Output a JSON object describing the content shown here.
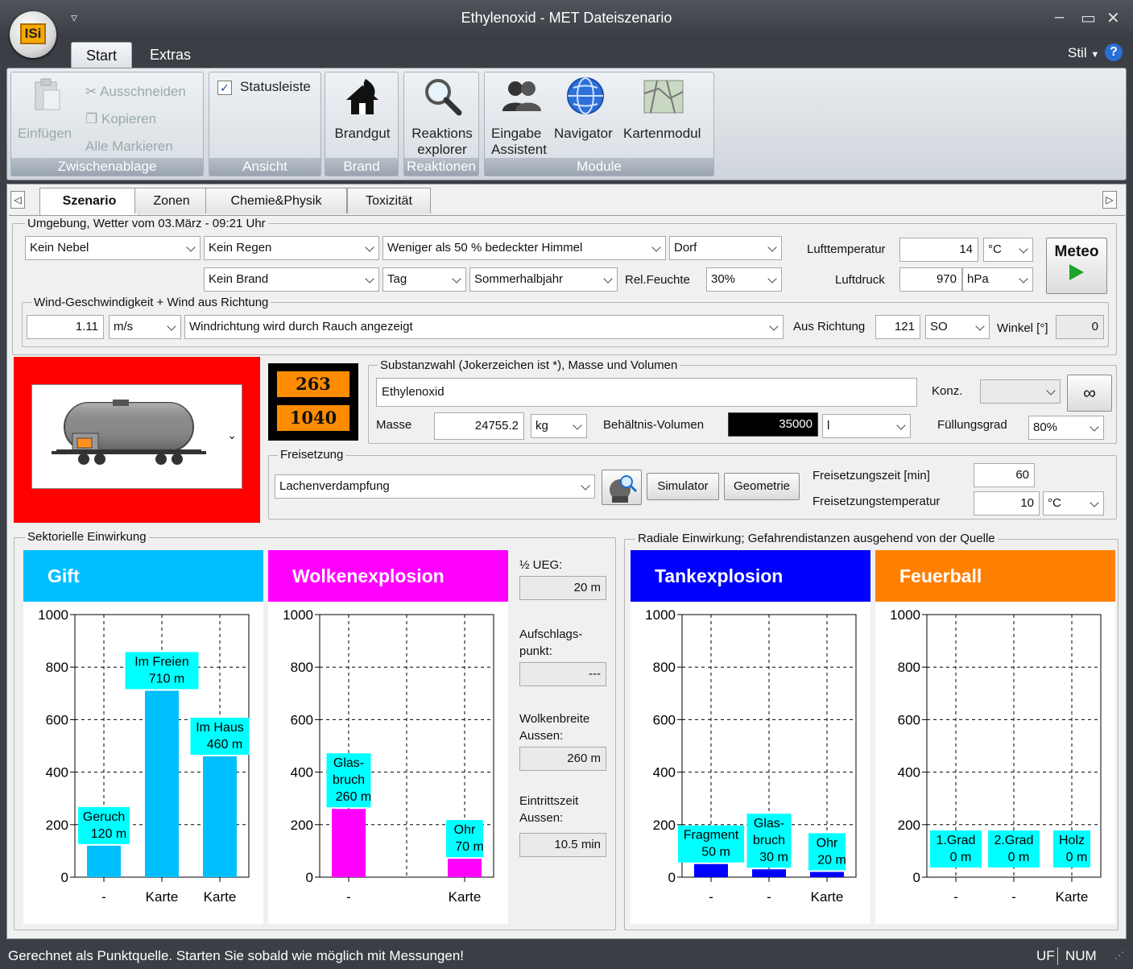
{
  "window": {
    "title": "Ethylenoxid - MET Dateiszenario",
    "logo": "ISi",
    "min": "–",
    "max": "▭",
    "close": "✕",
    "qat": "▿"
  },
  "ribbon": {
    "tabs": [
      "Start",
      "Extras"
    ],
    "style_label": "Stil",
    "help": "?",
    "clipboard": {
      "paste": "Einfügen",
      "cut": "Ausschneiden",
      "copy": "Kopieren",
      "select_all": "Alle Markieren",
      "caption": "Zwischenablage"
    },
    "view": {
      "statusbar": "Statusleiste",
      "caption": "Ansicht"
    },
    "fire": {
      "fuel": "Brandgut",
      "caption": "Brand"
    },
    "reactions": {
      "explorer_line1": "Reaktions",
      "explorer_line2": "explorer",
      "caption": "Reaktionen"
    },
    "modules": {
      "input_line1": "Eingabe",
      "input_line2": "Assistent",
      "navigator": "Navigator",
      "map": "Kartenmodul",
      "caption": "Module"
    }
  },
  "tabs": [
    "Szenario",
    "Zonen",
    "Chemie&Physik",
    "Toxizität"
  ],
  "environment": {
    "legend": "Umgebung, Wetter vom 03.März - 09:21 Uhr",
    "fog": "Kein Nebel",
    "rain": "Kein Regen",
    "sky": "Weniger als 50 % bedeckter Himmel",
    "terrain": "Dorf",
    "fire": "Kein Brand",
    "daytime": "Tag",
    "season": "Sommerhalbjahr",
    "humidity_label": "Rel.Feuchte",
    "humidity": "30%",
    "air_temp_label": "Lufttemperatur",
    "air_temp": "14",
    "air_temp_unit": "°C",
    "pressure_label": "Luftdruck",
    "pressure": "970",
    "pressure_unit": "hPa",
    "meteo_button": "Meteo",
    "wind_legend": "Wind-Geschwindigkeit + Wind aus Richtung",
    "wind_speed": "1.11",
    "wind_unit": "m/s",
    "wind_mode": "Windrichtung wird durch Rauch angezeigt",
    "direction_label": "Aus Richtung",
    "direction": "121",
    "direction_text": "SO",
    "angle_label": "Winkel [°]",
    "angle": "0"
  },
  "hazard_plate": {
    "top": "263",
    "bottom": "1040"
  },
  "substance": {
    "legend": "Substanzwahl (Jokerzeichen ist *), Masse und Volumen",
    "name": "Ethylenoxid",
    "conc_label": "Konz.",
    "conc": "",
    "mass_label": "Masse",
    "mass": "24755.2",
    "mass_unit": "kg",
    "volume_label": "Behältnis-Volumen",
    "volume": "35000",
    "volume_unit": "l",
    "fill_label": "Füllungsgrad",
    "fill": "80%"
  },
  "release": {
    "legend": "Freisetzung",
    "mode": "Lachenverdampfung",
    "simulator": "Simulator",
    "geometry": "Geometrie",
    "time_label": "Freisetzungszeit [min]",
    "time": "60",
    "temp_label": "Freisetzungstemperatur",
    "temp": "10",
    "temp_unit": "°C"
  },
  "sector": {
    "legend": "Sektorielle Einwirkung",
    "gift_title": "Gift",
    "cloud_title": "Wolkenexplosion",
    "ueg_label": "½ UEG:",
    "ueg": "20 m",
    "impact_label1": "Aufschlags-",
    "impact_label2": "punkt:",
    "impact": "---",
    "width_label1": "Wolkenbreite",
    "width_label2": "Aussen:",
    "width": "260 m",
    "entry_label1": "Eintrittszeit",
    "entry_label2": "Aussen:",
    "entry": "10.5 min"
  },
  "radial": {
    "legend": "Radiale Einwirkung;  Gefahrendistanzen ausgehend von der Quelle",
    "tank_title": "Tankexplosion",
    "fire_title": "Feuerball"
  },
  "chart_data": [
    {
      "type": "bar",
      "title": "Gift",
      "ylim": [
        0,
        1000
      ],
      "yticks": [
        0,
        200,
        400,
        600,
        800,
        1000
      ],
      "categories": [
        "-",
        "Karte",
        "Karte"
      ],
      "values": [
        120,
        710,
        460
      ],
      "labels": [
        [
          "Geruch",
          "120 m"
        ],
        [
          "Im Freien",
          "710 m"
        ],
        [
          "Im Haus",
          "460 m"
        ]
      ],
      "color": "#00bfff"
    },
    {
      "type": "bar",
      "title": "Wolkenexplosion",
      "ylim": [
        0,
        1000
      ],
      "yticks": [
        0,
        200,
        400,
        600,
        800,
        1000
      ],
      "categories": [
        "-",
        "Karte"
      ],
      "values": [
        260,
        70
      ],
      "labels": [
        [
          "Glas-",
          "bruch",
          "260 m"
        ],
        [
          "Ohr",
          "70 m"
        ]
      ],
      "color": "#ff00ff"
    },
    {
      "type": "bar",
      "title": "Tankexplosion",
      "ylim": [
        0,
        1000
      ],
      "yticks": [
        0,
        200,
        400,
        600,
        800,
        1000
      ],
      "categories": [
        "-",
        "-",
        "Karte"
      ],
      "values": [
        50,
        30,
        20
      ],
      "labels": [
        [
          "Fragment",
          "50 m"
        ],
        [
          "Glas-",
          "bruch",
          "30 m"
        ],
        [
          "Ohr",
          "20 m"
        ]
      ],
      "color": "#0000ff"
    },
    {
      "type": "bar",
      "title": "Feuerball",
      "ylim": [
        0,
        1000
      ],
      "yticks": [
        0,
        200,
        400,
        600,
        800,
        1000
      ],
      "categories": [
        "-",
        "-",
        "Karte"
      ],
      "values": [
        0,
        0,
        0
      ],
      "labels": [
        [
          "1.Grad",
          "0 m"
        ],
        [
          "2.Grad",
          "0 m"
        ],
        [
          "Holz",
          "0 m"
        ]
      ],
      "color": "#ff8000"
    }
  ],
  "colors": {
    "gift": "#00bfff",
    "cloud": "#ff00ff",
    "tank": "#0000ff",
    "fireball": "#ff8000",
    "label_bg": "#00ffff",
    "hazard": "#ff0000"
  },
  "statusbar": {
    "message": "Gerechnet als Punktquelle. Starten Sie sobald wie möglich mit Messungen!",
    "uf": "UF",
    "num": "NUM"
  }
}
